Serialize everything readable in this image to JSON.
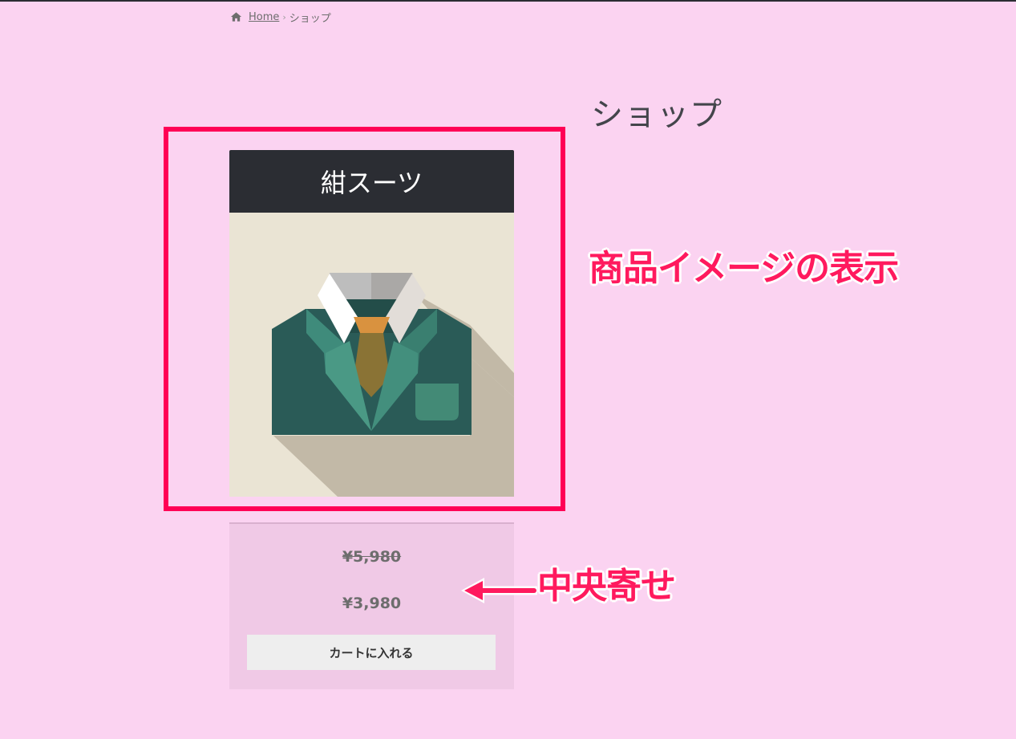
{
  "breadcrumb": {
    "home_label": "Home",
    "current": "ショップ"
  },
  "page": {
    "title": "ショップ"
  },
  "product": {
    "name": "紺スーツ",
    "image_icon": "suit-icon",
    "old_price": "¥5,980",
    "price": "¥3,980",
    "add_to_cart_label": "カートに入れる"
  },
  "annotations": {
    "image_note": "商品イメージの表示",
    "center_note": "中央寄せ"
  },
  "colors": {
    "background": "#fbd3f1",
    "banner": "#2b2d33",
    "highlight": "#ff0055",
    "annotation_text": "#ff1a5e",
    "price_panel": "#f0c9e6"
  }
}
